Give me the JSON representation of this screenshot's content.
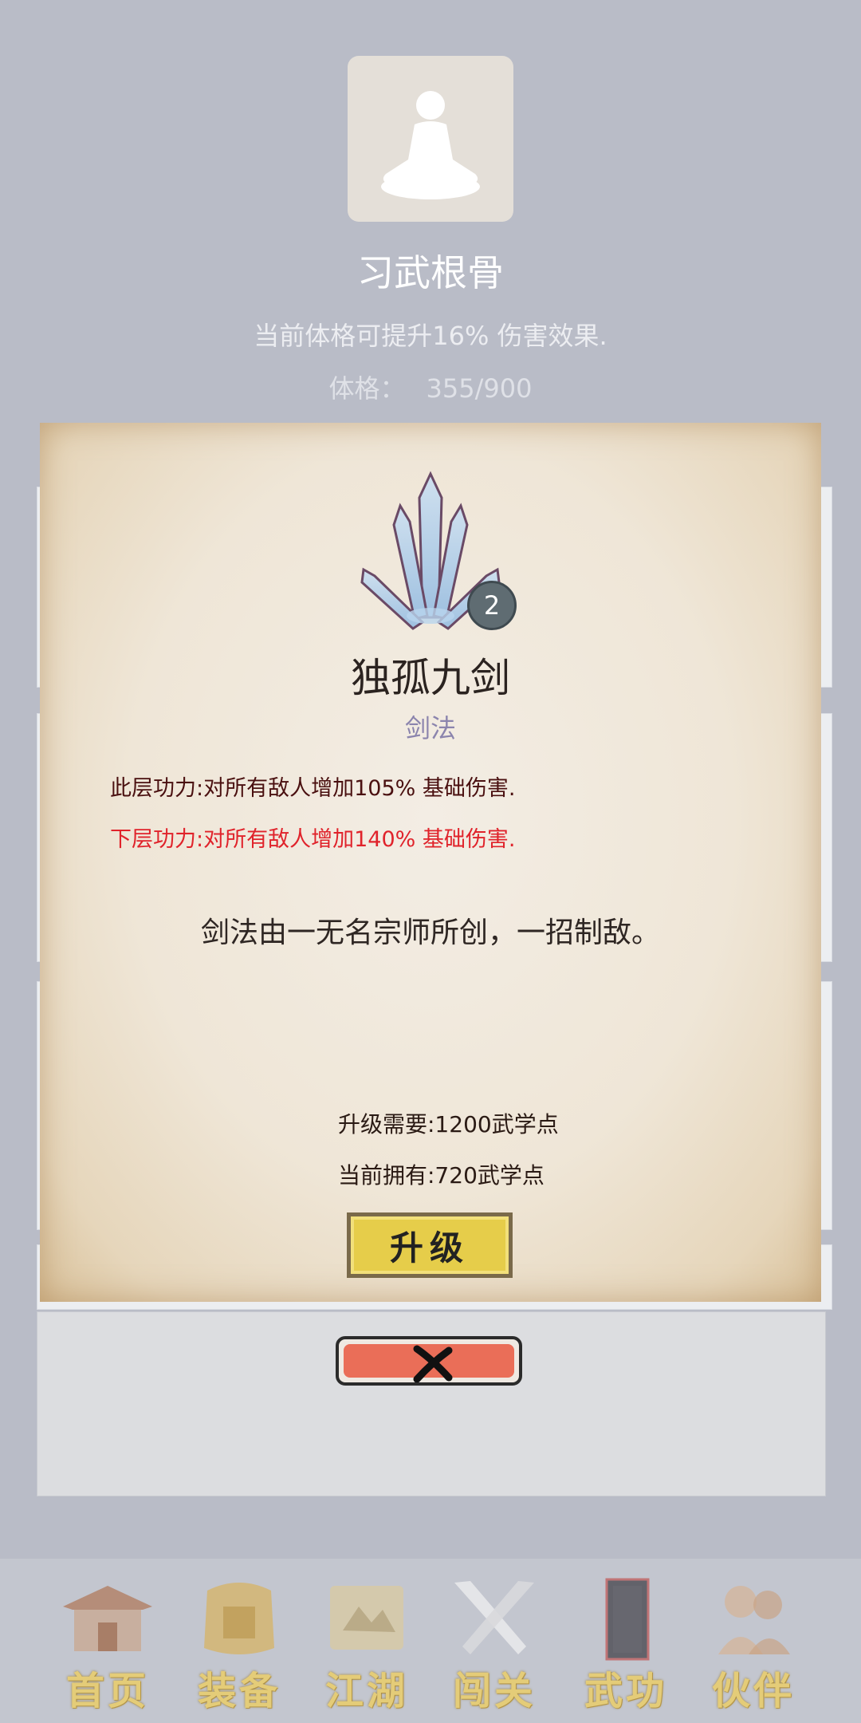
{
  "header": {
    "title": "习武根骨",
    "description": "当前体格可提升16% 伤害效果.",
    "stat_label": "体格：",
    "stat_value": "355/900"
  },
  "skill": {
    "name": "独孤九剑",
    "type": "剑法",
    "level": "2",
    "current_effect": "此层功力:对所有敌人增加105% 基础伤害.",
    "next_effect": "下层功力:对所有敌人增加140% 基础伤害.",
    "flavor": "剑法由一无名宗师所创，一招制敌。",
    "upgrade_cost": "升级需要:1200武学点",
    "current_points": "当前拥有:720武学点",
    "upgrade_label": "升级",
    "icon": "sword-fan-icon"
  },
  "colors": {
    "next_effect": "#e0232b",
    "current_effect": "#4a1010",
    "upgrade_button": "#e6cd4a",
    "close_button": "#ea6e58"
  },
  "nav": {
    "items": [
      {
        "label": "首页",
        "icon": "temple-icon"
      },
      {
        "label": "装备",
        "icon": "armor-icon"
      },
      {
        "label": "江湖",
        "icon": "scroll-map-icon"
      },
      {
        "label": "闯关",
        "icon": "crossed-swords-icon"
      },
      {
        "label": "武功",
        "icon": "book-icon"
      },
      {
        "label": "伙伴",
        "icon": "partners-icon"
      }
    ]
  }
}
